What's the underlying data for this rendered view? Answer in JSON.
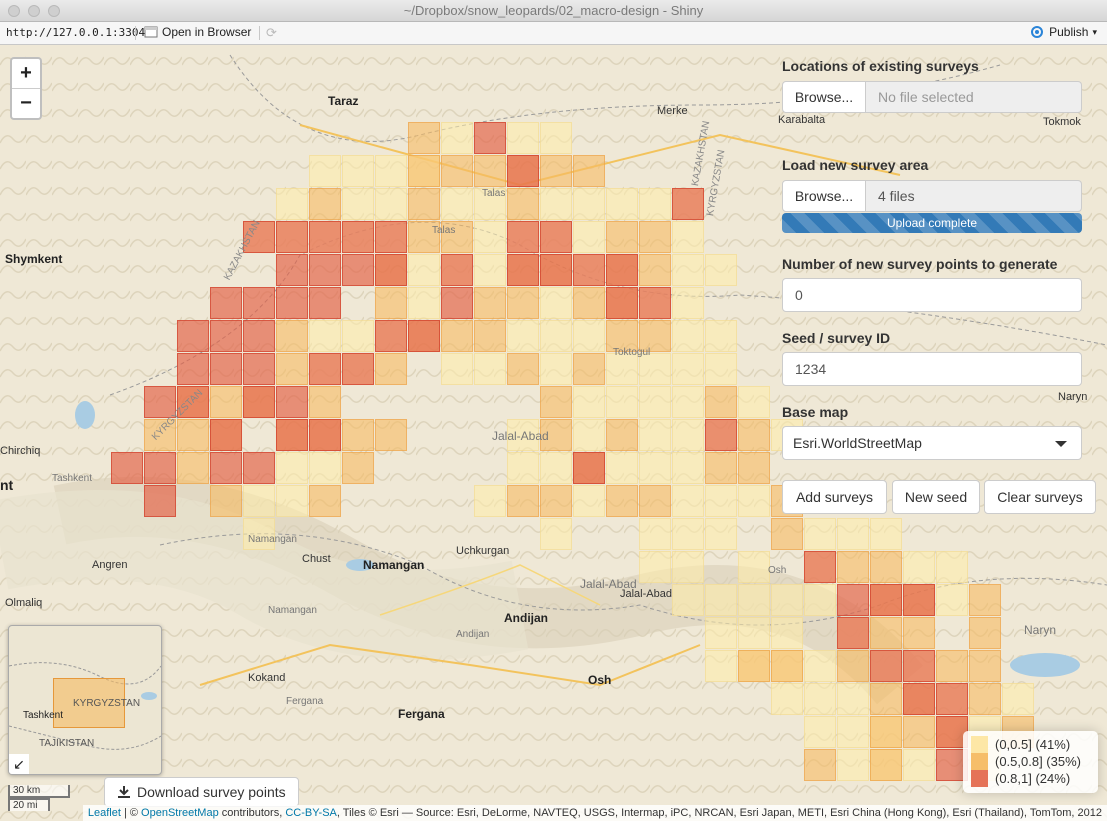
{
  "window": {
    "title": "~/Dropbox/snow_leopards/02_macro-design - Shiny"
  },
  "toolbar": {
    "url": "http://127.0.0.1:3304",
    "open_in_browser": "Open in Browser",
    "publish": "Publish"
  },
  "map": {
    "zoom_in": "+",
    "zoom_out": "−",
    "labels": [
      "Taraz",
      "Merke",
      "Karabalta",
      "Tokmok",
      "Shymkent",
      "Talas",
      "Talas",
      "Toktogul",
      "Jalal-Abad",
      "Jalal-Abad",
      "Jalal-Abad",
      "Chirchiq",
      "Tashkent",
      "Namangan",
      "Chust",
      "Namangan",
      "Uchkurgan",
      "Angren",
      "Olmaliq",
      "Namangan",
      "Andijan",
      "Andijan",
      "Osh",
      "Osh",
      "Kokand",
      "Fergana",
      "Fergana",
      "Naryn",
      "Naryn",
      "nt",
      "KAZAKHSTAN",
      "KYRGYZSTAN",
      "KAZAKHSTAN",
      "KYRGYZSTAN"
    ],
    "cells_low": [
      [
        13,
        4
      ],
      [
        15,
        4
      ],
      [
        16,
        4
      ],
      [
        9,
        5
      ],
      [
        10,
        5
      ],
      [
        11,
        5
      ],
      [
        12,
        5
      ],
      [
        8,
        6
      ],
      [
        10,
        6
      ],
      [
        11,
        6
      ],
      [
        13,
        6
      ],
      [
        14,
        6
      ],
      [
        16,
        6
      ],
      [
        17,
        6
      ],
      [
        18,
        6
      ],
      [
        19,
        6
      ],
      [
        20,
        6
      ],
      [
        7,
        7
      ],
      [
        8,
        7
      ],
      [
        9,
        7
      ],
      [
        10,
        7
      ],
      [
        11,
        7
      ],
      [
        14,
        7
      ],
      [
        15,
        7
      ],
      [
        16,
        7
      ],
      [
        17,
        7
      ],
      [
        20,
        7
      ],
      [
        12,
        8
      ],
      [
        13,
        8
      ],
      [
        14,
        8
      ],
      [
        17,
        8
      ],
      [
        20,
        8
      ],
      [
        21,
        8
      ],
      [
        12,
        9
      ],
      [
        16,
        9
      ],
      [
        19,
        9
      ],
      [
        20,
        9
      ],
      [
        9,
        10
      ],
      [
        10,
        10
      ],
      [
        11,
        10
      ],
      [
        15,
        10
      ],
      [
        16,
        10
      ],
      [
        17,
        10
      ],
      [
        20,
        10
      ],
      [
        21,
        10
      ],
      [
        9,
        11
      ],
      [
        10,
        11
      ],
      [
        13,
        11
      ],
      [
        14,
        11
      ],
      [
        16,
        11
      ],
      [
        18,
        11
      ],
      [
        19,
        11
      ],
      [
        20,
        11
      ],
      [
        21,
        11
      ],
      [
        17,
        12
      ],
      [
        18,
        12
      ],
      [
        19,
        12
      ],
      [
        20,
        12
      ],
      [
        22,
        12
      ],
      [
        15,
        13
      ],
      [
        17,
        13
      ],
      [
        19,
        13
      ],
      [
        20,
        13
      ],
      [
        21,
        13
      ],
      [
        23,
        13
      ],
      [
        8,
        14
      ],
      [
        9,
        14
      ],
      [
        15,
        14
      ],
      [
        16,
        14
      ],
      [
        18,
        14
      ],
      [
        19,
        14
      ],
      [
        20,
        14
      ],
      [
        7,
        15
      ],
      [
        8,
        15
      ],
      [
        14,
        15
      ],
      [
        17,
        15
      ],
      [
        20,
        15
      ],
      [
        21,
        15
      ],
      [
        22,
        15
      ],
      [
        7,
        16
      ],
      [
        16,
        16
      ],
      [
        19,
        16
      ],
      [
        20,
        16
      ],
      [
        21,
        16
      ],
      [
        24,
        16
      ],
      [
        25,
        16
      ],
      [
        26,
        16
      ],
      [
        19,
        17
      ],
      [
        20,
        17
      ],
      [
        22,
        17
      ],
      [
        24,
        17
      ],
      [
        27,
        17
      ],
      [
        28,
        17
      ],
      [
        20,
        18
      ],
      [
        21,
        18
      ],
      [
        22,
        18
      ],
      [
        23,
        18
      ],
      [
        24,
        18
      ],
      [
        28,
        18
      ],
      [
        21,
        19
      ],
      [
        22,
        19
      ],
      [
        23,
        19
      ],
      [
        25,
        19
      ],
      [
        21,
        20
      ],
      [
        22,
        20
      ],
      [
        23,
        20
      ],
      [
        24,
        20
      ],
      [
        26,
        20
      ],
      [
        27,
        20
      ],
      [
        23,
        21
      ],
      [
        24,
        21
      ],
      [
        25,
        21
      ],
      [
        28,
        21
      ],
      [
        30,
        21
      ],
      [
        24,
        22
      ],
      [
        25,
        22
      ],
      [
        26,
        22
      ],
      [
        29,
        22
      ],
      [
        25,
        23
      ],
      [
        26,
        23
      ],
      [
        27,
        23
      ],
      [
        29,
        23
      ]
    ],
    "cells_mid": [
      [
        12,
        4
      ],
      [
        12,
        5
      ],
      [
        13,
        5
      ],
      [
        14,
        5
      ],
      [
        15,
        5
      ],
      [
        16,
        5
      ],
      [
        17,
        5
      ],
      [
        9,
        6
      ],
      [
        12,
        6
      ],
      [
        15,
        6
      ],
      [
        12,
        7
      ],
      [
        13,
        7
      ],
      [
        18,
        7
      ],
      [
        19,
        7
      ],
      [
        11,
        8
      ],
      [
        15,
        8
      ],
      [
        16,
        8
      ],
      [
        18,
        8
      ],
      [
        19,
        8
      ],
      [
        11,
        9
      ],
      [
        14,
        9
      ],
      [
        15,
        9
      ],
      [
        17,
        9
      ],
      [
        18,
        9
      ],
      [
        8,
        10
      ],
      [
        12,
        10
      ],
      [
        13,
        10
      ],
      [
        14,
        10
      ],
      [
        18,
        10
      ],
      [
        19,
        10
      ],
      [
        8,
        11
      ],
      [
        11,
        11
      ],
      [
        15,
        11
      ],
      [
        17,
        11
      ],
      [
        5,
        12
      ],
      [
        6,
        12
      ],
      [
        7,
        12
      ],
      [
        9,
        12
      ],
      [
        16,
        12
      ],
      [
        21,
        12
      ],
      [
        4,
        13
      ],
      [
        5,
        13
      ],
      [
        6,
        13
      ],
      [
        8,
        13
      ],
      [
        9,
        13
      ],
      [
        10,
        13
      ],
      [
        11,
        13
      ],
      [
        16,
        13
      ],
      [
        18,
        13
      ],
      [
        22,
        13
      ],
      [
        5,
        14
      ],
      [
        10,
        14
      ],
      [
        17,
        14
      ],
      [
        21,
        14
      ],
      [
        22,
        14
      ],
      [
        6,
        15
      ],
      [
        9,
        15
      ],
      [
        15,
        15
      ],
      [
        16,
        15
      ],
      [
        18,
        15
      ],
      [
        19,
        15
      ],
      [
        23,
        15
      ],
      [
        23,
        16
      ],
      [
        25,
        17
      ],
      [
        26,
        17
      ],
      [
        26,
        18
      ],
      [
        27,
        18
      ],
      [
        29,
        18
      ],
      [
        26,
        19
      ],
      [
        27,
        19
      ],
      [
        29,
        19
      ],
      [
        22,
        20
      ],
      [
        25,
        20
      ],
      [
        28,
        20
      ],
      [
        29,
        20
      ],
      [
        23,
        20
      ],
      [
        26,
        21
      ],
      [
        27,
        21
      ],
      [
        29,
        21
      ],
      [
        26,
        22
      ],
      [
        27,
        22
      ],
      [
        28,
        22
      ],
      [
        30,
        22
      ],
      [
        24,
        23
      ],
      [
        26,
        23
      ]
    ],
    "cells_high": [
      [
        14,
        4
      ],
      [
        15,
        5
      ],
      [
        7,
        7
      ],
      [
        8,
        7
      ],
      [
        9,
        7
      ],
      [
        10,
        7
      ],
      [
        11,
        7
      ],
      [
        15,
        7
      ],
      [
        16,
        7
      ],
      [
        20,
        6
      ],
      [
        8,
        8
      ],
      [
        9,
        8
      ],
      [
        10,
        8
      ],
      [
        11,
        8
      ],
      [
        13,
        8
      ],
      [
        15,
        8
      ],
      [
        16,
        8
      ],
      [
        17,
        8
      ],
      [
        18,
        8
      ],
      [
        6,
        9
      ],
      [
        7,
        9
      ],
      [
        8,
        9
      ],
      [
        9,
        9
      ],
      [
        13,
        9
      ],
      [
        18,
        9
      ],
      [
        19,
        9
      ],
      [
        5,
        10
      ],
      [
        6,
        10
      ],
      [
        7,
        10
      ],
      [
        11,
        10
      ],
      [
        12,
        10
      ],
      [
        5,
        11
      ],
      [
        6,
        11
      ],
      [
        7,
        11
      ],
      [
        9,
        11
      ],
      [
        10,
        11
      ],
      [
        4,
        12
      ],
      [
        5,
        12
      ],
      [
        7,
        12
      ],
      [
        8,
        12
      ],
      [
        6,
        13
      ],
      [
        8,
        13
      ],
      [
        9,
        13
      ],
      [
        21,
        13
      ],
      [
        3,
        14
      ],
      [
        4,
        14
      ],
      [
        6,
        14
      ],
      [
        7,
        14
      ],
      [
        17,
        14
      ],
      [
        4,
        15
      ],
      [
        24,
        17
      ],
      [
        25,
        18
      ],
      [
        26,
        18
      ],
      [
        27,
        18
      ],
      [
        25,
        19
      ],
      [
        26,
        20
      ],
      [
        27,
        20
      ],
      [
        27,
        21
      ],
      [
        28,
        21
      ],
      [
        28,
        22
      ],
      [
        28,
        23
      ]
    ]
  },
  "panel": {
    "existing_label": "Locations of existing surveys",
    "existing_browse": "Browse...",
    "existing_file": "No file selected",
    "load_label": "Load new survey area",
    "load_browse": "Browse...",
    "load_file": "4 files",
    "upload_status": "Upload complete",
    "npoints_label": "Number of new survey points to generate",
    "npoints_value": "0",
    "seed_label": "Seed / survey ID",
    "seed_value": "1234",
    "basemap_label": "Base map",
    "basemap_value": "Esri.WorldStreetMap",
    "add_button": "Add surveys",
    "newseed_button": "New seed",
    "clear_button": "Clear surveys"
  },
  "minimap": {
    "labels": [
      "KYRGYZSTAN",
      "Tashkent",
      "TAJIKISTAN"
    ],
    "toggle": "↙"
  },
  "download": {
    "label": "Download survey points",
    "icon": "download-icon"
  },
  "scale": {
    "metric": "30 km",
    "imperial": "20 mi"
  },
  "legend": {
    "items": [
      {
        "label": "(0,0.5] (41%)",
        "color": "#fde7a6"
      },
      {
        "label": "(0.5,0.8] (35%)",
        "color": "#f6be6a"
      },
      {
        "label": "(0.8,1] (24%)",
        "color": "#e57358"
      }
    ]
  },
  "attribution": {
    "leaflet": "Leaflet",
    "sep1": " | © ",
    "osm": "OpenStreetMap",
    "contrib": " contributors, ",
    "ccbysa": "CC-BY-SA",
    "tiles": ", Tiles © Esri — Source: Esri, DeLorme, NAVTEQ, USGS, Intermap, iPC, NRCAN, Esri Japan, METI, Esri China (Hong Kong), Esri (Thailand), TomTom, 2012"
  }
}
